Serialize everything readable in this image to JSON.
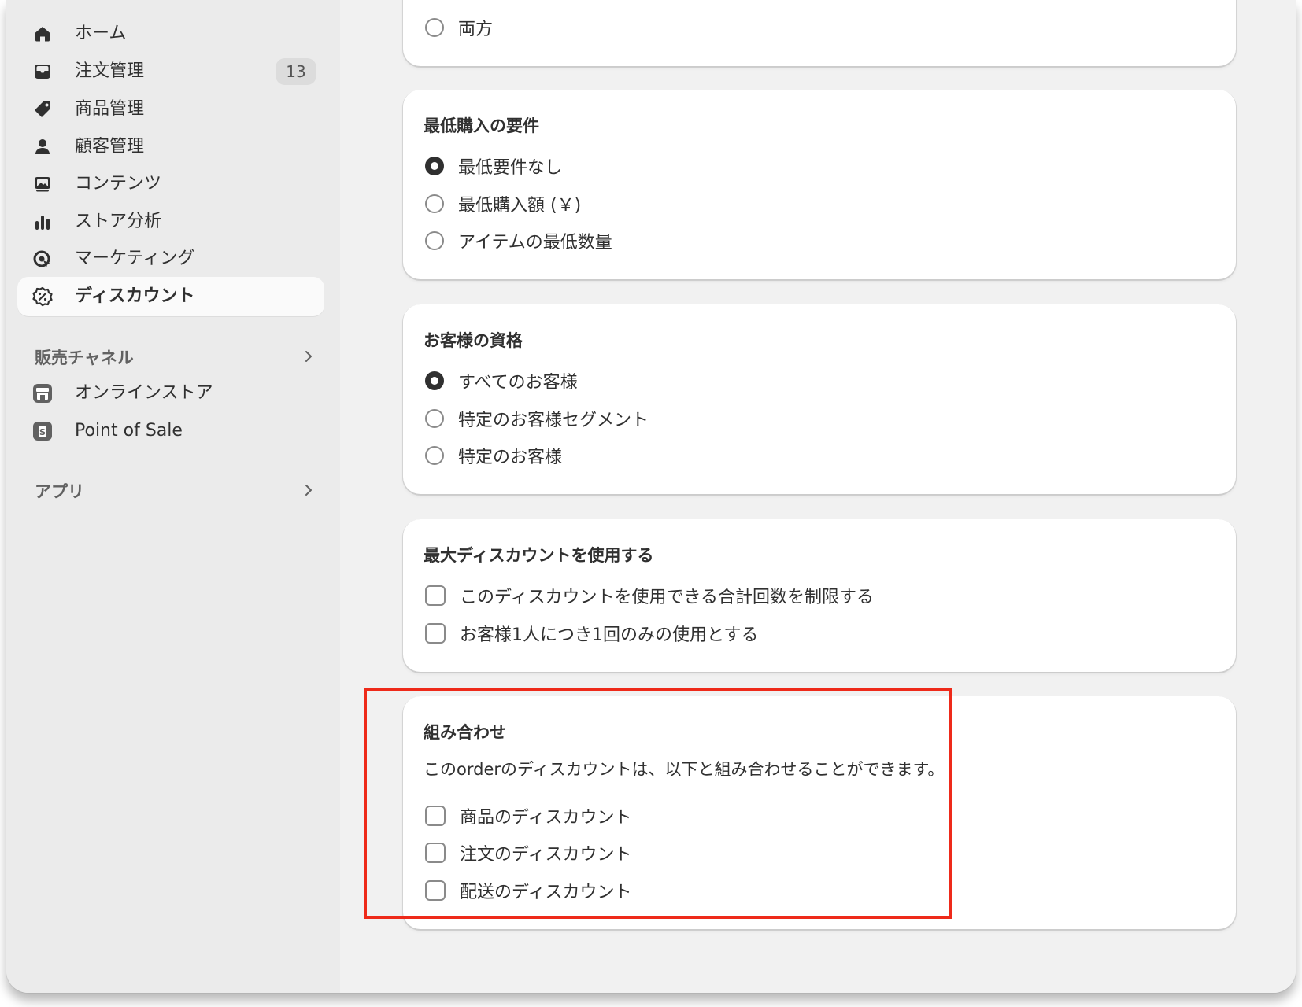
{
  "sidebar": {
    "items": [
      {
        "label": "ホーム",
        "icon": "home-icon"
      },
      {
        "label": "注文管理",
        "icon": "inbox-icon",
        "badge": "13"
      },
      {
        "label": "商品管理",
        "icon": "tag-icon"
      },
      {
        "label": "顧客管理",
        "icon": "person-icon"
      },
      {
        "label": "コンテンツ",
        "icon": "content-icon"
      },
      {
        "label": "ストア分析",
        "icon": "analytics-icon"
      },
      {
        "label": "マーケティング",
        "icon": "marketing-icon"
      },
      {
        "label": "ディスカウント",
        "icon": "discount-icon",
        "active": true
      }
    ],
    "channels_heading": "販売チャネル",
    "channels": [
      {
        "label": "オンラインストア",
        "icon": "store-icon"
      },
      {
        "label": "Point of Sale",
        "icon": "pos-icon"
      }
    ],
    "apps_heading": "アプリ"
  },
  "cards": {
    "applies_to": {
      "option_both": "両方"
    },
    "minimum": {
      "title": "最低購入の要件",
      "options": [
        "最低要件なし",
        "最低購入額 (￥)",
        "アイテムの最低数量"
      ],
      "selected_index": 0
    },
    "eligibility": {
      "title": "お客様の資格",
      "options": [
        "すべてのお客様",
        "特定のお客様セグメント",
        "特定のお客様"
      ],
      "selected_index": 0
    },
    "max_uses": {
      "title": "最大ディスカウントを使用する",
      "options": [
        "このディスカウントを使用できる合計回数を制限する",
        "お客様1人につき1回のみの使用とする"
      ]
    },
    "combinations": {
      "title": "組み合わせ",
      "description": "このorderのディスカウントは、以下と組み合わせることができます。",
      "options": [
        "商品のディスカウント",
        "注文のディスカウント",
        "配送のディスカウント"
      ]
    }
  },
  "colors": {
    "highlight": "#ee2a1a",
    "sidebar_bg": "#ebebeb",
    "main_bg": "#f1f1f1"
  }
}
